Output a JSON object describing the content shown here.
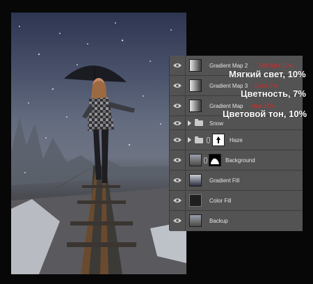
{
  "layers": [
    {
      "name": "Gradient Map 2",
      "blend": "Soft light 10%",
      "type": "gradient-map"
    },
    {
      "name": "Gradient Map 3",
      "blend": "Color 7%",
      "type": "gradient-map"
    },
    {
      "name": "Gradient Map",
      "blend": "Hue 10%",
      "type": "gradient-map"
    },
    {
      "name": "Snow",
      "type": "group"
    },
    {
      "name": "Haze",
      "type": "group"
    },
    {
      "name": "Background",
      "type": "photo-mask"
    },
    {
      "name": "Gradient Fill",
      "type": "gradient-fill"
    },
    {
      "name": "Color Fill",
      "type": "color-fill"
    },
    {
      "name": "Backup",
      "type": "photo"
    }
  ],
  "captions": [
    "Мягкий свет, 10%",
    "Цветность, 7%",
    "Цветовой тон, 10%"
  ],
  "colors": {
    "panel_bg": "#535353",
    "blend_text": "#e02424",
    "caption_text": "#ffffff"
  }
}
